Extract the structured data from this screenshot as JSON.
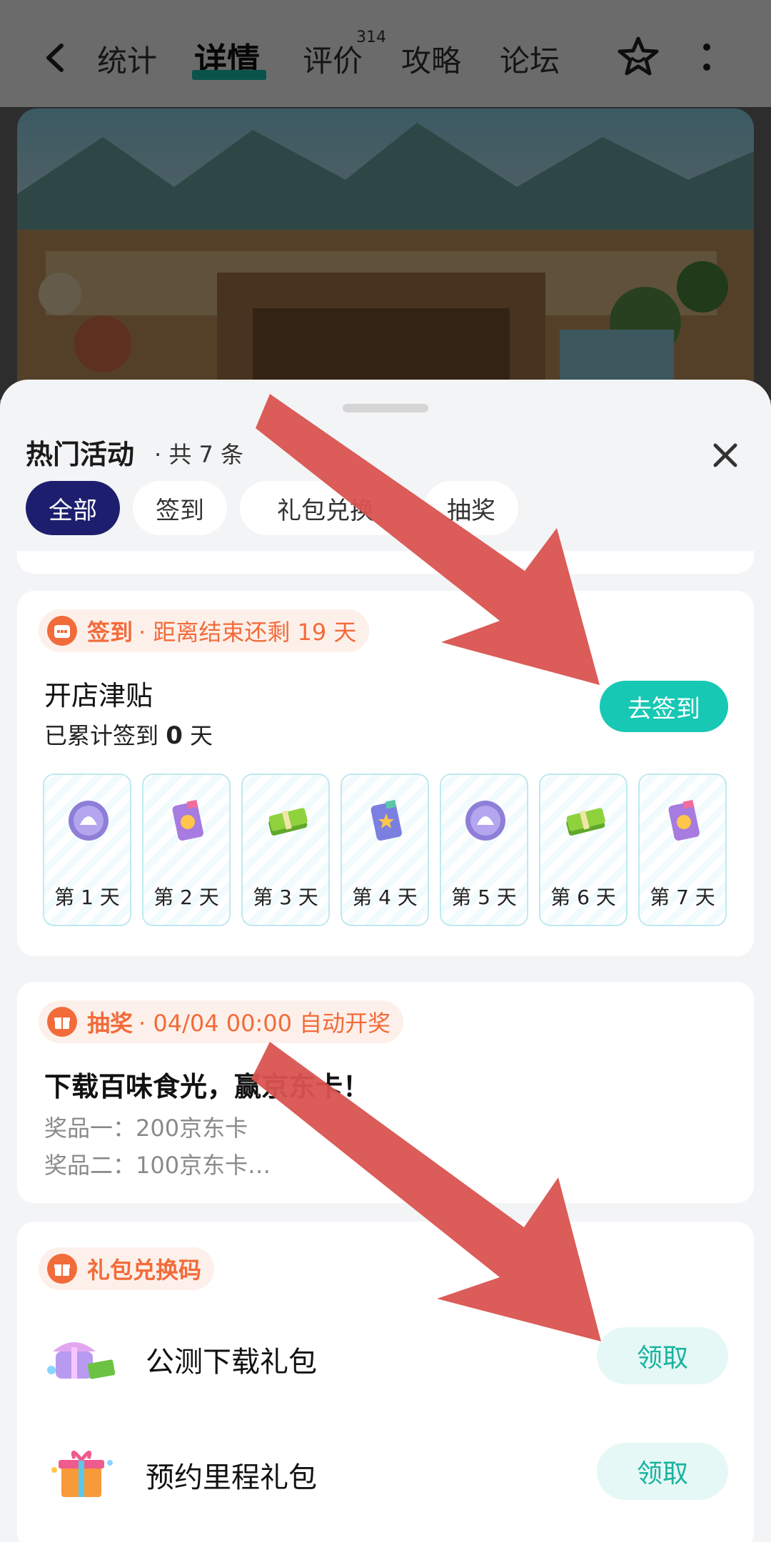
{
  "nav": {
    "tabs": [
      {
        "label": "统计"
      },
      {
        "label": "详情"
      },
      {
        "label": "评价",
        "badge": "314"
      },
      {
        "label": "攻略"
      },
      {
        "label": "论坛"
      }
    ],
    "active_tab": "详情"
  },
  "sheet": {
    "title": "热门活动",
    "count": "· 共 7 条",
    "filters": [
      "全部",
      "签到",
      "礼包兑换",
      "抽奖"
    ],
    "active_filter": "全部"
  },
  "checkin": {
    "tag": "签到",
    "tag_sub": "· 距离结束还剩 19 天",
    "title": "开店津贴",
    "sub_prefix": "已累计签到 ",
    "sub_num": "0",
    "sub_suffix": " 天",
    "button": "去签到",
    "days": [
      {
        "label": "第 1 天",
        "icon": "shell-coin-icon"
      },
      {
        "label": "第 2 天",
        "icon": "treat-pack-icon"
      },
      {
        "label": "第 3 天",
        "icon": "cash-stack-icon"
      },
      {
        "label": "第 4 天",
        "icon": "star-pack-icon"
      },
      {
        "label": "第 5 天",
        "icon": "shell-coin-icon"
      },
      {
        "label": "第 6 天",
        "icon": "cash-stack-icon"
      },
      {
        "label": "第 7 天",
        "icon": "treat-pack-icon"
      }
    ]
  },
  "lottery": {
    "tag": "抽奖",
    "tag_sub": "· 04/04 00:00 自动开奖",
    "title": "下载百味食光，赢京东卡！",
    "prize1": "奖品一：200京东卡",
    "prize2": "奖品二：100京东卡…"
  },
  "gifts": {
    "tag": "礼包兑换码",
    "items": [
      {
        "name": "公测下载礼包",
        "button": "领取"
      },
      {
        "name": "预约里程礼包",
        "button": "领取"
      }
    ]
  },
  "colors": {
    "accent": "#17c8b4",
    "tag": "#f26b3a",
    "chip_active": "#1d1f6e",
    "arrow": "#d9534f"
  }
}
